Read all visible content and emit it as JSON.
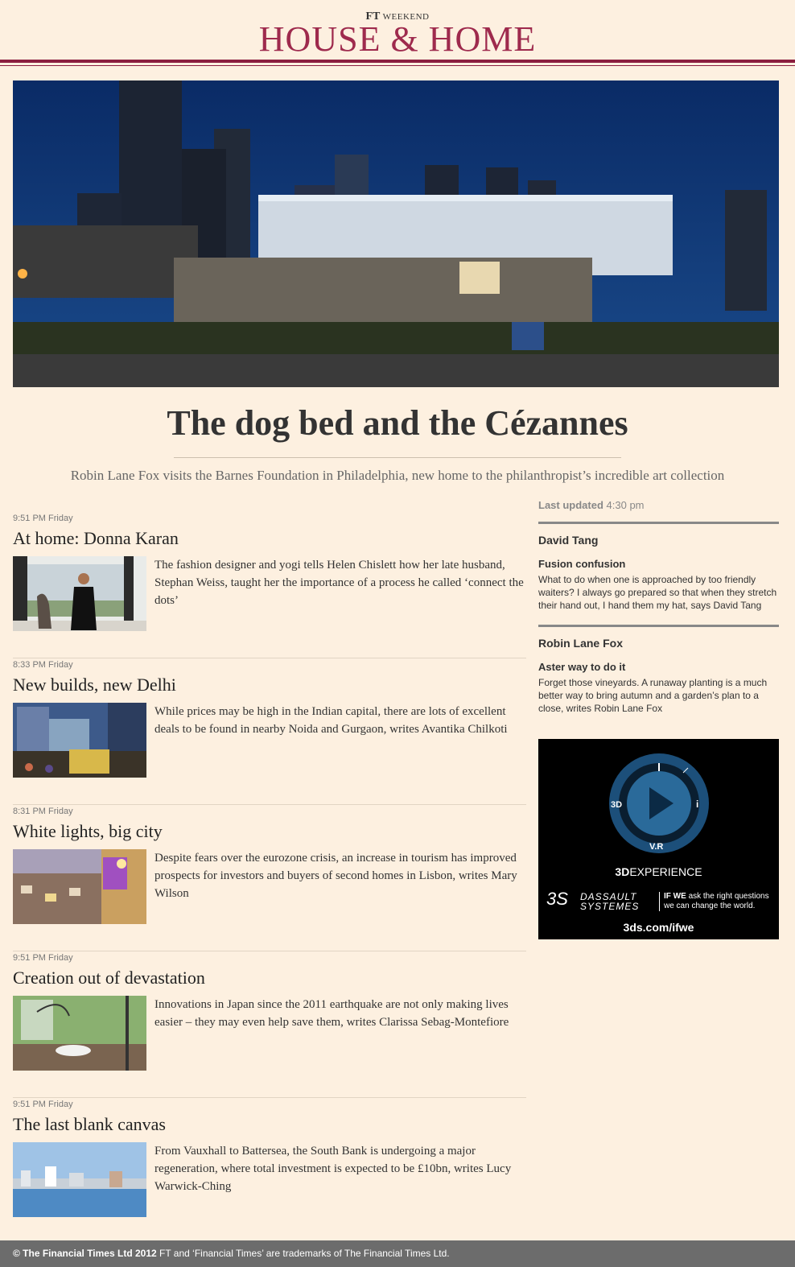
{
  "masthead": {
    "ft": "FT",
    "weekend": "WEEKEND",
    "brand": "HOUSE & HOME"
  },
  "lead": {
    "headline": "The dog bed and the Cézannes",
    "standfirst": "Robin Lane Fox visits the Barnes Foundation in Philadelphia, new home to the philanthropist’s incredible art collection"
  },
  "articles": [
    {
      "time": "9:51 PM Friday",
      "title": "At home: Donna Karan",
      "summary": "The fashion designer and yogi tells Helen Chislett how her late husband, Stephan Weiss, taught her the importance of a process he called ‘connect the dots’"
    },
    {
      "time": "8:33 PM Friday",
      "title": "New builds, new Delhi",
      "summary": "While prices may be high in the Indian capital, there are lots of excellent deals to be found in nearby Noida and Gurgaon, writes Avantika Chilkoti"
    },
    {
      "time": "8:31 PM Friday",
      "title": "White lights, big city",
      "summary": "Despite fears over the eurozone crisis, an increase in tourism has improved prospects for investors and buyers of second homes in Lisbon, writes Mary Wilson"
    },
    {
      "time": "9:51 PM Friday",
      "title": "Creation out of devastation",
      "summary": "Innovations in Japan since the 2011 earthquake are not only making lives easier – they may even help save them, writes Clarissa Sebag-Montefiore"
    },
    {
      "time": "9:51 PM Friday",
      "title": "The last blank canvas",
      "summary": "From Vauxhall to Battersea, the South Bank is undergoing a major regeneration, where total investment is expected to be £10bn, writes Lucy Warwick-Ching"
    }
  ],
  "sidebar": {
    "updated_label": "Last updated",
    "updated_time": "4:30 pm",
    "columns": [
      {
        "author": "David Tang",
        "title": "Fusion confusion",
        "summary": "What to do when one is approached by too friendly waiters? I always go prepared so that when they stretch their hand out, I hand them my hat, says David Tang"
      },
      {
        "author": "Robin Lane Fox",
        "title": "Aster way to do it",
        "summary": "Forget those vineyards. A runaway planting is a much better way to bring autumn and a garden’s plan to a close, writes Robin Lane Fox"
      }
    ]
  },
  "ad": {
    "label_3d": "3D",
    "label_i": "i",
    "label_vr": "V.R",
    "experience_bold": "3D",
    "experience": "EXPERIENCE",
    "logo": "3S",
    "brand_line1": "DASSAULT",
    "brand_line2": "SYSTEMES",
    "tagline_bold": "IF WE",
    "tagline": "ask the right questions we can change the world.",
    "url": "3ds.com/ifwe"
  },
  "footer": {
    "copyright": "© The Financial Times Ltd 2012",
    "trademark": "FT and ‘Financial Times’ are trademarks of The Financial Times Ltd."
  }
}
